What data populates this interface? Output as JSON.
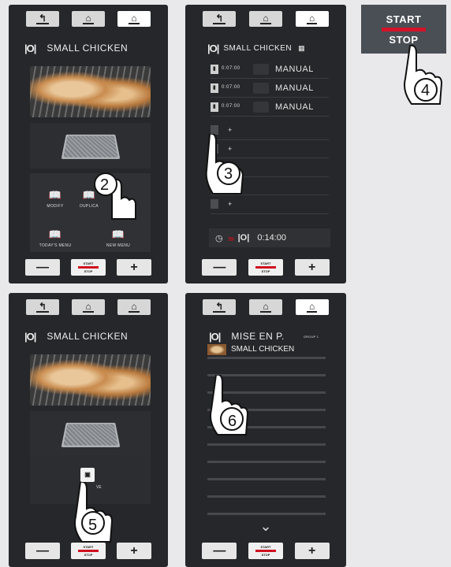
{
  "icons": {
    "back": "back-icon",
    "home_settings": "home-settings-icon",
    "home": "home-icon",
    "minus": "minus-icon",
    "plus": "plus-icon"
  },
  "labels": {
    "small_chicken": "SMALL CHICKEN",
    "mise_en_p": "MISE EN P.",
    "group_1": "GROUP 1",
    "start": "START",
    "stop": "STOP",
    "manual": "MANUAL",
    "step_time": "0:07:00",
    "total_time": "0:14:00",
    "modify": "MODIFY",
    "duplicate": "DUPLICA",
    "todays_menu": "TODAY'S MENU",
    "new_menu": "NEW MENU",
    "save_partial": "VE",
    "plus_sign": "+",
    "minus_sign": "—"
  },
  "callouts": [
    "2",
    "3",
    "4",
    "5",
    "6"
  ],
  "colors": {
    "panel": "#25272a",
    "stop_red": "#d01020"
  }
}
